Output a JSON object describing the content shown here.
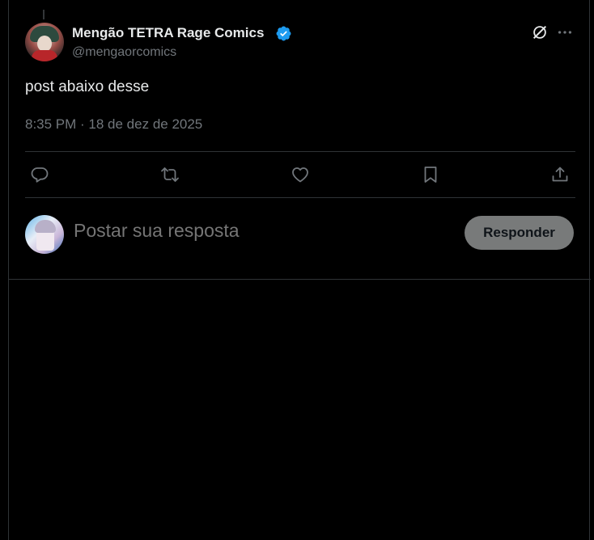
{
  "post": {
    "author": {
      "display_name": "Mengão TETRA Rage Comics",
      "handle": "@mengaorcomics",
      "verified": true,
      "avatar_icon": "avatar"
    },
    "text": "post abaixo desse",
    "meta": "8:35 PM · 18 de dez de 2025"
  },
  "header_icons": [
    "verified-badge-icon",
    "grok-icon",
    "more-icon"
  ],
  "actions": [
    {
      "name": "reply-icon"
    },
    {
      "name": "retweet-icon"
    },
    {
      "name": "like-icon"
    },
    {
      "name": "bookmark-icon"
    },
    {
      "name": "share-icon"
    }
  ],
  "reply_box": {
    "placeholder": "Postar sua resposta",
    "button_label": "Responder"
  },
  "colors": {
    "background": "#000000",
    "text": "#e7e9ea",
    "muted": "#71767b",
    "border": "#2f3336",
    "verified": "#1d9bf0",
    "button_disabled": "#787a7a"
  }
}
